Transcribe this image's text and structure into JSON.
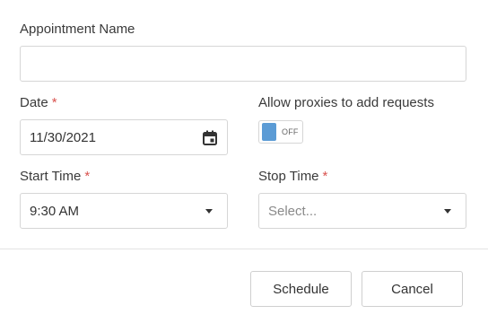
{
  "appointment": {
    "label": "Appointment Name",
    "value": ""
  },
  "date": {
    "label": "Date",
    "required_mark": "*",
    "value": "11/30/2021",
    "icon": "calendar-icon"
  },
  "proxies": {
    "label": "Allow proxies to add requests",
    "toggle_text": "OFF",
    "state": "off",
    "accent": "#5b9bd5"
  },
  "start_time": {
    "label": "Start Time",
    "required_mark": "*",
    "value": "9:30 AM"
  },
  "stop_time": {
    "label": "Stop Time",
    "required_mark": "*",
    "placeholder": "Select..."
  },
  "buttons": {
    "schedule": "Schedule",
    "cancel": "Cancel"
  },
  "colors": {
    "required": "#d9534f",
    "border": "#d6d6d6"
  }
}
